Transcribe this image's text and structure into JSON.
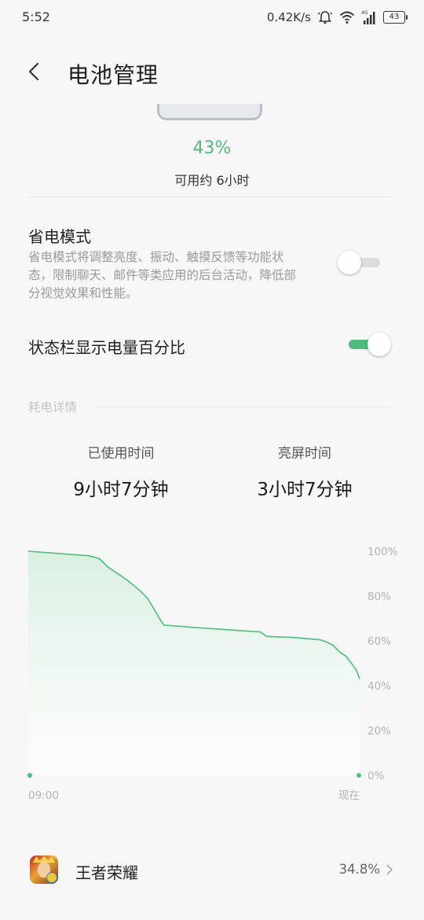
{
  "status_bar": {
    "time": "5:52",
    "net_speed": "0.42K/s",
    "network_type": "4G",
    "battery_level": "43",
    "icons": [
      "alarm-icon",
      "wifi-icon",
      "signal-icon",
      "battery-icon"
    ]
  },
  "header": {
    "title": "电池管理",
    "back_icon": "back-chevron-icon"
  },
  "battery": {
    "percent": "43%",
    "remaining": "可用约 6小时"
  },
  "power_saving": {
    "title": "省电模式",
    "description": "省电模式将调整亮度、振动、触摸反馈等功能状态，限制聊天、邮件等类应用的后台活动，降低部分视觉效果和性能。",
    "enabled": false
  },
  "status_bar_percent": {
    "label": "状态栏显示电量百分比",
    "enabled": true
  },
  "usage_details": {
    "section_label": "耗电详情",
    "used_time_label": "已使用时间",
    "used_time_value": "9小时7分钟",
    "screen_time_label": "亮屏时间",
    "screen_time_value": "3小时7分钟"
  },
  "colors": {
    "accent": "#4cbd7a",
    "percent_text": "#55b87c",
    "muted_text": "#9a9a9a"
  },
  "chart_data": {
    "type": "area",
    "x_labels": [
      "09:00",
      "现在"
    ],
    "y_ticks": [
      "100%",
      "80%",
      "60%",
      "40%",
      "20%",
      "0%"
    ],
    "ylim": [
      0,
      100
    ],
    "x": [
      0,
      0.18,
      0.21,
      0.22,
      0.24,
      0.3,
      0.34,
      0.36,
      0.38,
      0.4,
      0.41,
      0.46,
      0.5,
      0.6,
      0.7,
      0.72,
      0.8,
      0.88,
      0.9,
      0.92,
      0.94,
      0.96,
      0.98,
      0.99,
      1.0
    ],
    "values": [
      100,
      98,
      97,
      96,
      93,
      87,
      82,
      79,
      74,
      69,
      67,
      66.5,
      66,
      65,
      64,
      62,
      61.5,
      60.5,
      59.5,
      58,
      55,
      53,
      49,
      47,
      43
    ],
    "grid": false
  },
  "app_list": [
    {
      "name": "王者荣耀",
      "percent": "34.8%",
      "icon": "honor-of-kings-app-icon"
    }
  ]
}
